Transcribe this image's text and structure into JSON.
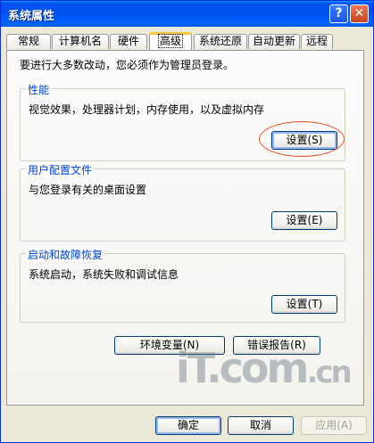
{
  "window": {
    "title": "系统属性",
    "help": "?",
    "close": "✕"
  },
  "tabs": [
    "常规",
    "计算机名",
    "硬件",
    "高级",
    "系统还原",
    "自动更新",
    "远程"
  ],
  "intro": "要进行大多数改动，您必须作为管理员登录。",
  "groups": {
    "performance": {
      "label": "性能",
      "desc": "视觉效果，处理器计划，内存使用，以及虚拟内存",
      "button": "设置(S)"
    },
    "profiles": {
      "label": "用户配置文件",
      "desc": "与您登录有关的桌面设置",
      "button": "设置(E)"
    },
    "startup": {
      "label": "启动和故障恢复",
      "desc": "系统启动，系统失败和调试信息",
      "button": "设置(T)"
    }
  },
  "env_button": "环境变量(N)",
  "error_button": "错误报告(R)",
  "watermark": {
    "main": "iT.com",
    "suffix": ".cn"
  },
  "footer": {
    "ok": "确定",
    "cancel": "取消",
    "apply": "应用(A)"
  },
  "colors": {
    "titlebar": "#0054e3",
    "group_label": "#0046d5",
    "highlight_ring": "#e85020"
  }
}
